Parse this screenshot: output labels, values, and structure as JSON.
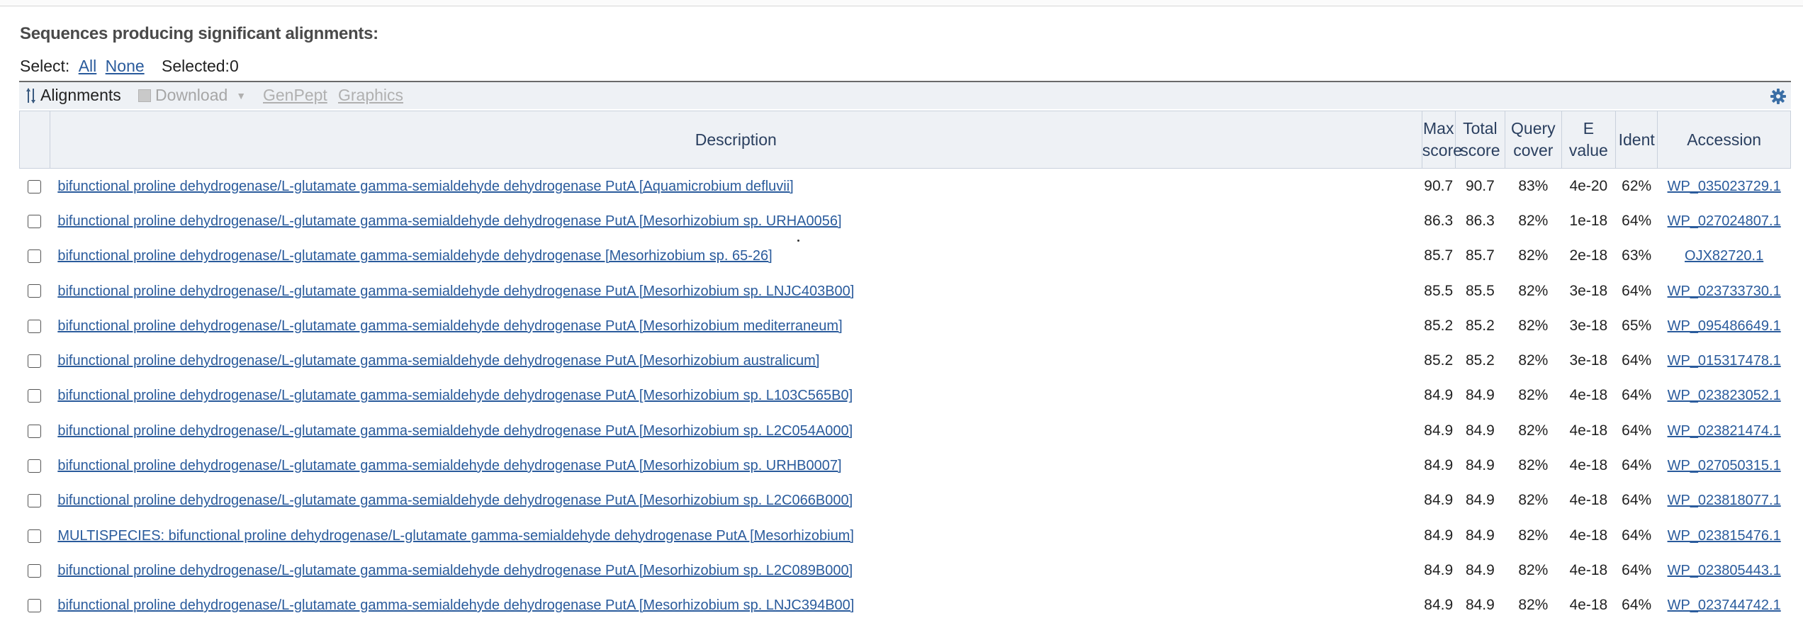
{
  "heading": "Sequences producing significant alignments:",
  "select": {
    "label": "Select:",
    "all": "All",
    "none": "None",
    "selected": "Selected:0"
  },
  "toolbar": {
    "alignments": "Alignments",
    "download": "Download",
    "genpept": "GenPept",
    "graphics": "Graphics",
    "icons": {
      "alignments": "alignments-icon",
      "download": "floppy-disk-icon",
      "settings": "gear-icon"
    }
  },
  "columns": {
    "description": "Description",
    "max_score": [
      "Max",
      "score"
    ],
    "total_score": [
      "Total",
      "score"
    ],
    "query_cover": [
      "Query",
      "cover"
    ],
    "e_value": [
      "E",
      "value"
    ],
    "ident": "Ident",
    "accession": "Accession"
  },
  "rows": [
    {
      "desc": "bifunctional proline dehydrogenase/L-glutamate gamma-semialdehyde dehydrogenase PutA [Aquamicrobium defluvii]",
      "max": "90.7",
      "total": "90.7",
      "cover": "83%",
      "evalue": "4e-20",
      "ident": "62%",
      "acc": "WP_035023729.1"
    },
    {
      "desc": "bifunctional proline dehydrogenase/L-glutamate gamma-semialdehyde dehydrogenase PutA [Mesorhizobium sp. URHA0056]",
      "max": "86.3",
      "total": "86.3",
      "cover": "82%",
      "evalue": "1e-18",
      "ident": "64%",
      "acc": "WP_027024807.1"
    },
    {
      "desc": "bifunctional proline dehydrogenase/L-glutamate gamma-semialdehyde dehydrogenase [Mesorhizobium sp. 65-26]",
      "max": "85.7",
      "total": "85.7",
      "cover": "82%",
      "evalue": "2e-18",
      "ident": "63%",
      "acc": "OJX82720.1"
    },
    {
      "desc": "bifunctional proline dehydrogenase/L-glutamate gamma-semialdehyde dehydrogenase PutA [Mesorhizobium sp. LNJC403B00]",
      "max": "85.5",
      "total": "85.5",
      "cover": "82%",
      "evalue": "3e-18",
      "ident": "64%",
      "acc": "WP_023733730.1"
    },
    {
      "desc": "bifunctional proline dehydrogenase/L-glutamate gamma-semialdehyde dehydrogenase PutA [Mesorhizobium mediterraneum]",
      "max": "85.2",
      "total": "85.2",
      "cover": "82%",
      "evalue": "3e-18",
      "ident": "65%",
      "acc": "WP_095486649.1"
    },
    {
      "desc": "bifunctional proline dehydrogenase/L-glutamate gamma-semialdehyde dehydrogenase PutA [Mesorhizobium australicum]",
      "max": "85.2",
      "total": "85.2",
      "cover": "82%",
      "evalue": "3e-18",
      "ident": "64%",
      "acc": "WP_015317478.1"
    },
    {
      "desc": "bifunctional proline dehydrogenase/L-glutamate gamma-semialdehyde dehydrogenase PutA [Mesorhizobium sp. L103C565B0]",
      "max": "84.9",
      "total": "84.9",
      "cover": "82%",
      "evalue": "4e-18",
      "ident": "64%",
      "acc": "WP_023823052.1"
    },
    {
      "desc": "bifunctional proline dehydrogenase/L-glutamate gamma-semialdehyde dehydrogenase PutA [Mesorhizobium sp. L2C054A000]",
      "max": "84.9",
      "total": "84.9",
      "cover": "82%",
      "evalue": "4e-18",
      "ident": "64%",
      "acc": "WP_023821474.1"
    },
    {
      "desc": "bifunctional proline dehydrogenase/L-glutamate gamma-semialdehyde dehydrogenase PutA [Mesorhizobium sp. URHB0007]",
      "max": "84.9",
      "total": "84.9",
      "cover": "82%",
      "evalue": "4e-18",
      "ident": "64%",
      "acc": "WP_027050315.1"
    },
    {
      "desc": "bifunctional proline dehydrogenase/L-glutamate gamma-semialdehyde dehydrogenase PutA [Mesorhizobium sp. L2C066B000]",
      "max": "84.9",
      "total": "84.9",
      "cover": "82%",
      "evalue": "4e-18",
      "ident": "64%",
      "acc": "WP_023818077.1"
    },
    {
      "desc": "MULTISPECIES: bifunctional proline dehydrogenase/L-glutamate gamma-semialdehyde dehydrogenase PutA [Mesorhizobium]",
      "max": "84.9",
      "total": "84.9",
      "cover": "82%",
      "evalue": "4e-18",
      "ident": "64%",
      "acc": "WP_023815476.1"
    },
    {
      "desc": "bifunctional proline dehydrogenase/L-glutamate gamma-semialdehyde dehydrogenase PutA [Mesorhizobium sp. L2C089B000]",
      "max": "84.9",
      "total": "84.9",
      "cover": "82%",
      "evalue": "4e-18",
      "ident": "64%",
      "acc": "WP_023805443.1"
    },
    {
      "desc": "bifunctional proline dehydrogenase/L-glutamate gamma-semialdehyde dehydrogenase PutA [Mesorhizobium sp. LNJC394B00]",
      "max": "84.9",
      "total": "84.9",
      "cover": "82%",
      "evalue": "4e-18",
      "ident": "64%",
      "acc": "WP_023744742.1"
    }
  ]
}
